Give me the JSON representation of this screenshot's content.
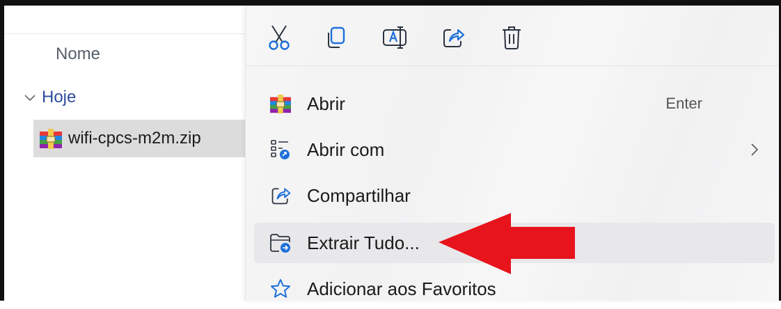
{
  "explorer": {
    "column_header": "Nome",
    "group_label": "Hoje",
    "file_name": "wifi-cpcs-m2m.zip"
  },
  "context_menu": {
    "toolbar_icons": [
      "cut-icon",
      "copy-icon",
      "rename-icon",
      "share-icon",
      "delete-icon"
    ],
    "items": [
      {
        "label": "Abrir",
        "icon": "winrar-icon",
        "shortcut": "Enter"
      },
      {
        "label": "Abrir com",
        "icon": "open-with-icon",
        "has_submenu": true
      },
      {
        "label": "Compartilhar",
        "icon": "share-icon"
      },
      {
        "label": "Extrair Tudo...",
        "icon": "extract-folder-icon",
        "highlighted": true
      },
      {
        "label": "Adicionar aos Favoritos",
        "icon": "star-icon"
      }
    ]
  },
  "annotation": {
    "arrow_color": "#e8141c",
    "points_to": "Extrair Tudo..."
  },
  "colors": {
    "accent": "#1e6fd9",
    "group_text": "#2b4c9e",
    "hover_bg": "#e8e8ea"
  }
}
